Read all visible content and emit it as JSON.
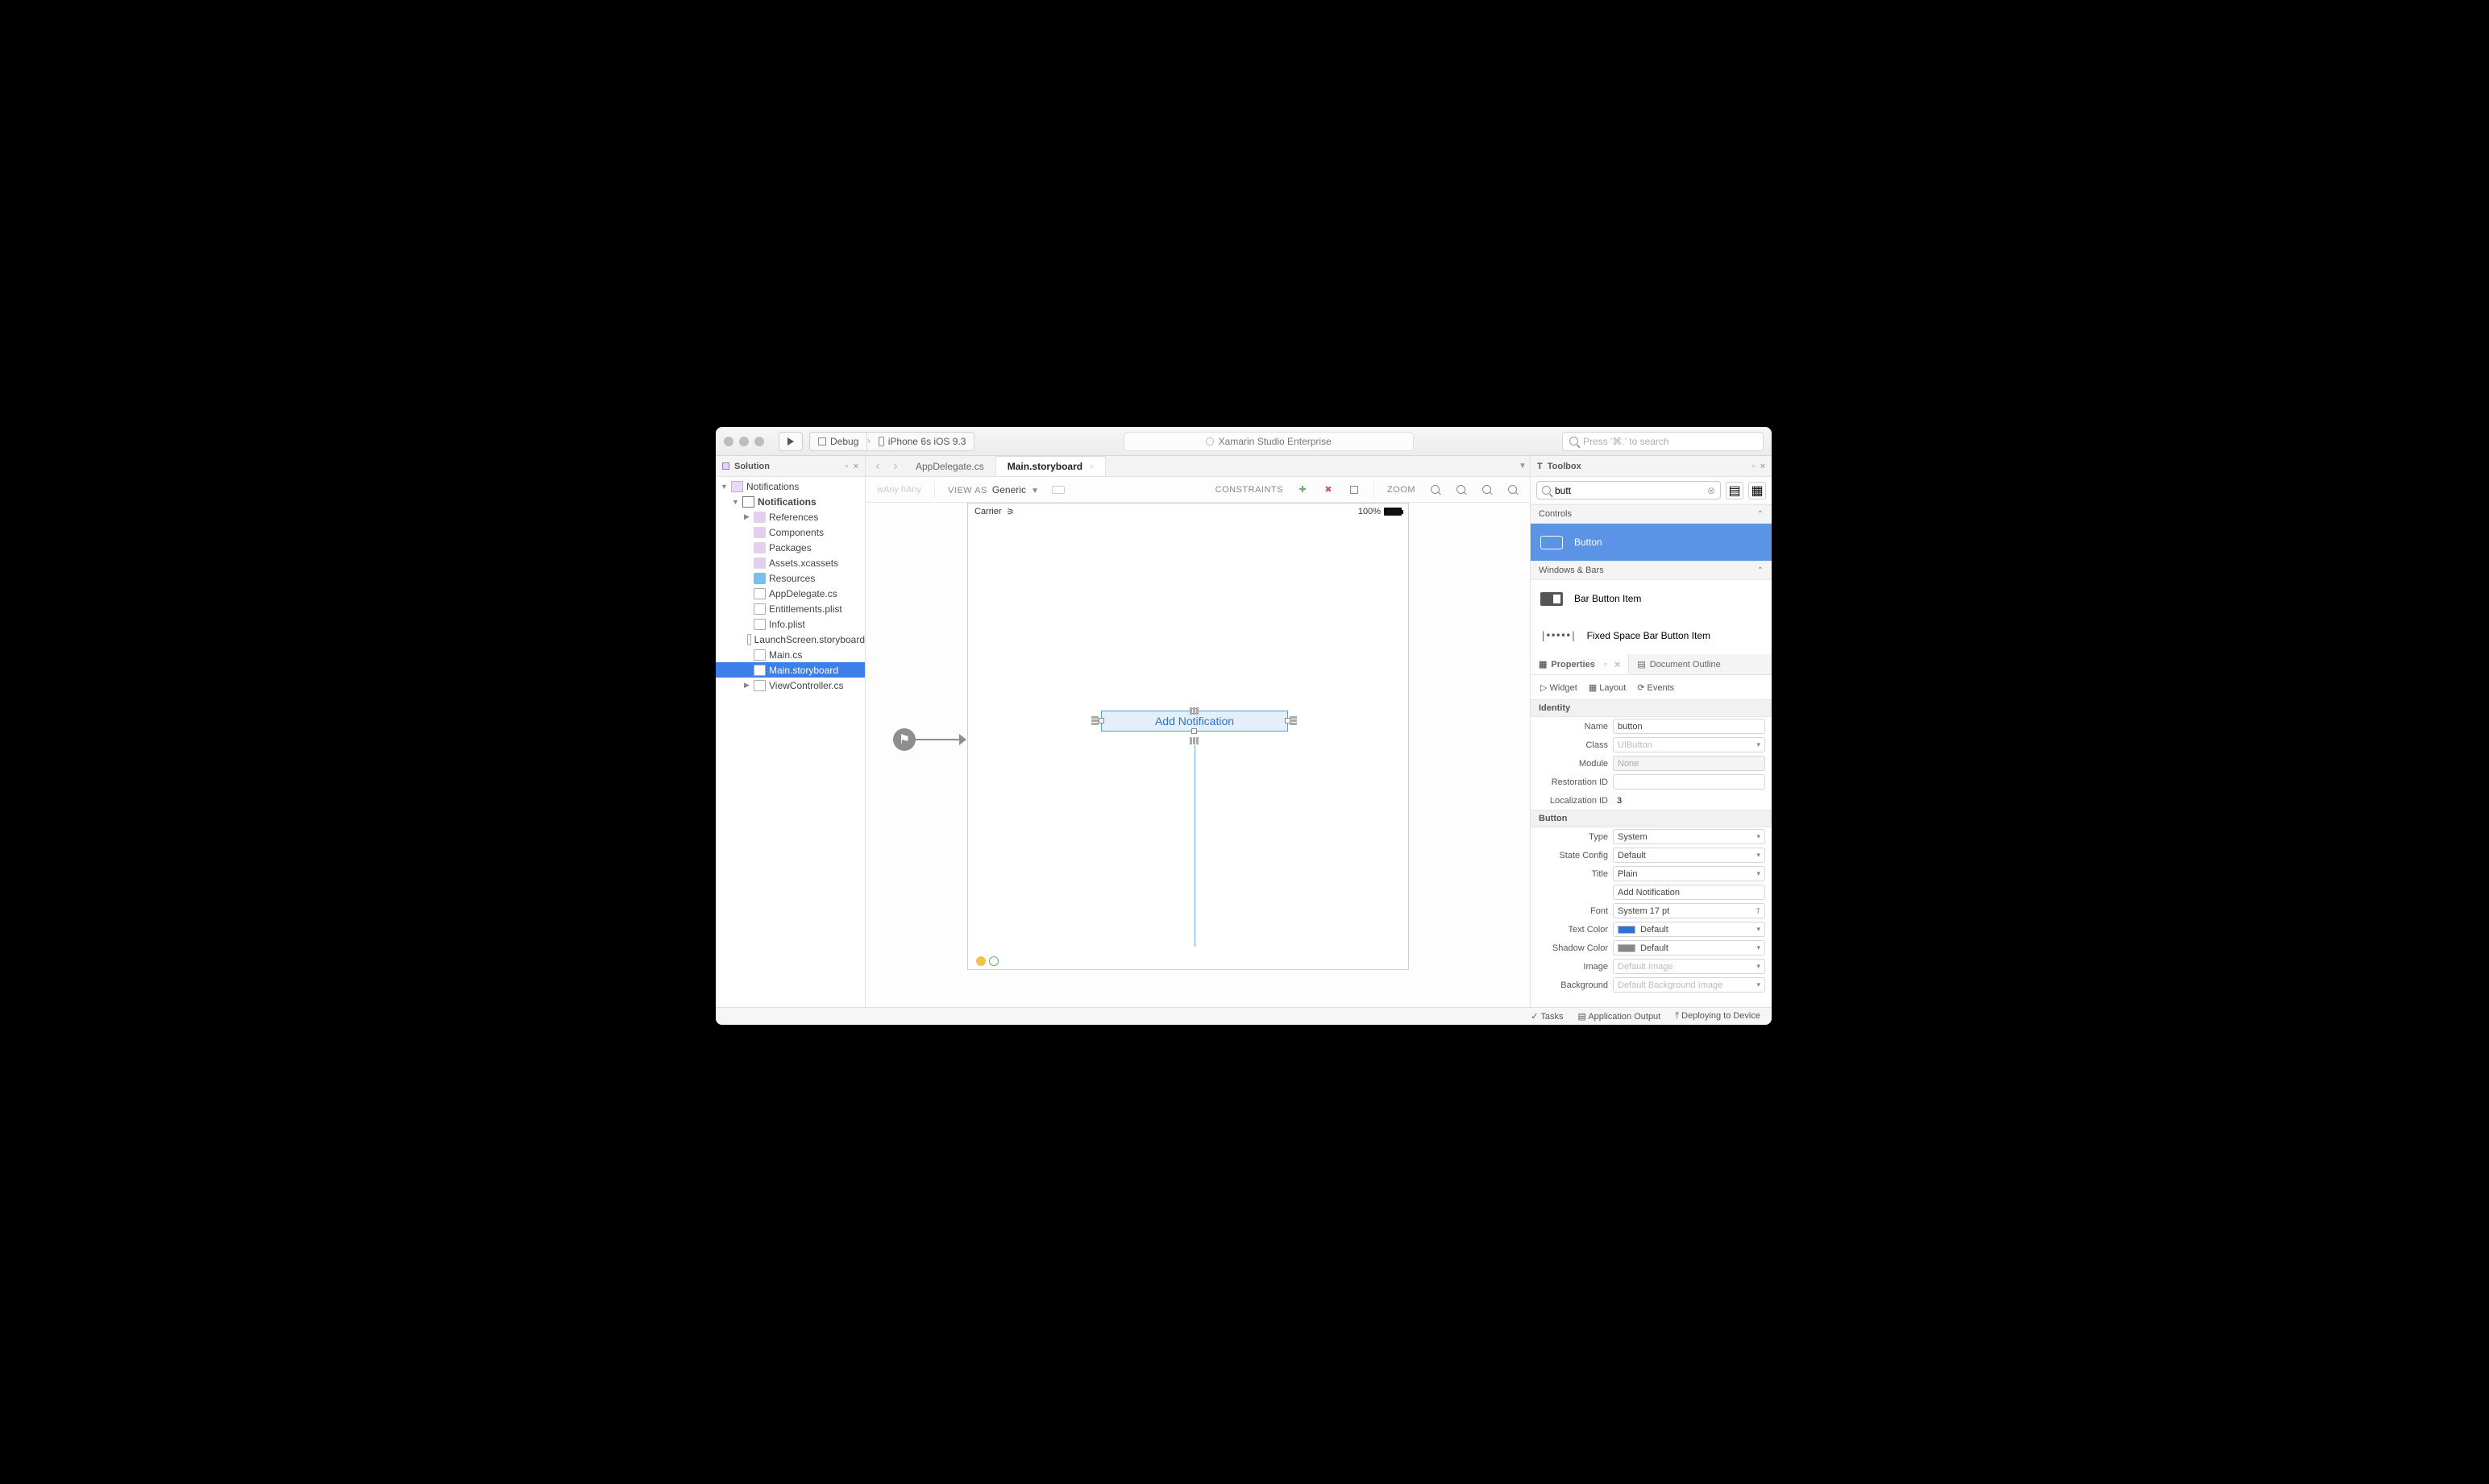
{
  "toolbar": {
    "config": "Debug",
    "device": "iPhone 6s iOS 9.3",
    "title": "Xamarin Studio Enterprise",
    "search_placeholder": "Press '⌘.' to search"
  },
  "solution": {
    "header": "Solution",
    "root": "Notifications",
    "project": "Notifications",
    "items": {
      "references": "References",
      "components": "Components",
      "packages": "Packages",
      "assets": "Assets.xcassets",
      "resources": "Resources",
      "appdelegate": "AppDelegate.cs",
      "entitlements": "Entitlements.plist",
      "infoplist": "Info.plist",
      "launchscreen": "LaunchScreen.storyboard",
      "maincs": "Main.cs",
      "mainsb": "Main.storyboard",
      "viewcontroller": "ViewController.cs"
    }
  },
  "tabs": {
    "t1": "AppDelegate.cs",
    "t2": "Main.storyboard"
  },
  "designer": {
    "size_w": "wAny",
    "size_h": "hAny",
    "viewas_label": "VIEW AS",
    "viewas": "Generic",
    "constraints_label": "CONSTRAINTS",
    "zoom_label": "ZOOM",
    "carrier": "Carrier",
    "battery": "100%",
    "button_text": "Add Notification"
  },
  "toolbox": {
    "header": "Toolbox",
    "search_value": "butt",
    "cat1": "Controls",
    "item1": "Button",
    "cat2": "Windows & Bars",
    "item2": "Bar Button Item",
    "item3": "Fixed Space Bar Button Item"
  },
  "properties": {
    "tab_props": "Properties",
    "tab_outline": "Document Outline",
    "sub_widget": "Widget",
    "sub_layout": "Layout",
    "sub_events": "Events",
    "sect_identity": "Identity",
    "name_label": "Name",
    "name_value": "button",
    "class_label": "Class",
    "class_value": "UIButton",
    "module_label": "Module",
    "module_value": "None",
    "restoration_label": "Restoration ID",
    "restoration_value": "",
    "localization_label": "Localization ID",
    "localization_value": "3",
    "sect_button": "Button",
    "type_label": "Type",
    "type_value": "System",
    "state_label": "State Config",
    "state_value": "Default",
    "title_label": "Title",
    "title_value": "Plain",
    "title_text_value": "Add Notification",
    "font_label": "Font",
    "font_value": "System 17 pt",
    "textcolor_label": "Text Color",
    "textcolor_value": "Default",
    "shadowcolor_label": "Shadow Color",
    "shadowcolor_value": "Default",
    "image_label": "Image",
    "image_value": "Default Image",
    "background_label": "Background",
    "background_value": "Default Background Image"
  },
  "status": {
    "tasks": "Tasks",
    "output": "Application Output",
    "deploy": "Deploying to Device"
  }
}
